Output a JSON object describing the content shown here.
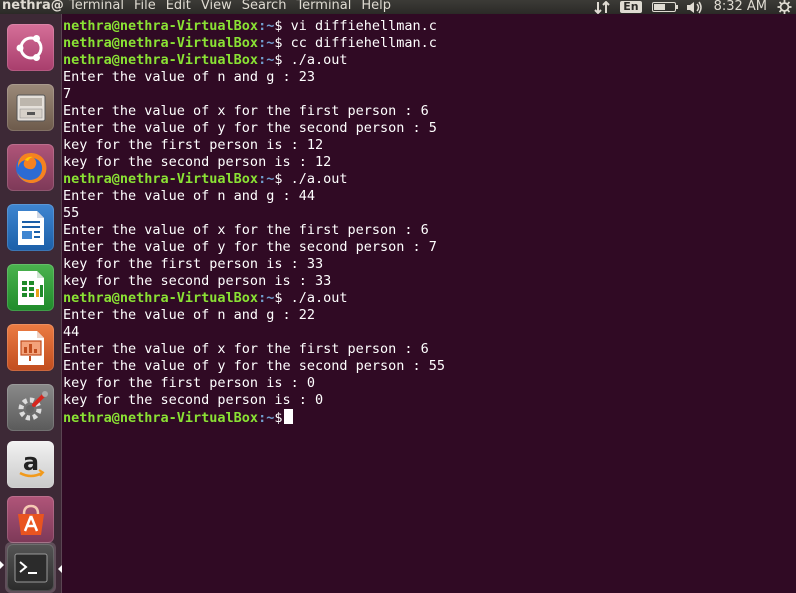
{
  "top_panel": {
    "app_title": "nethra@",
    "menu": [
      "Terminal",
      "File",
      "Edit",
      "View",
      "Search",
      "Terminal",
      "Help"
    ],
    "keyboard_layout": "En",
    "clock": "8:32 AM",
    "battery_level": 0.55,
    "icons": [
      "network-updown-icon",
      "keyboard-icon",
      "battery-icon",
      "volume-icon",
      "gear-icon"
    ]
  },
  "launcher": {
    "items": [
      {
        "name": "ubuntu-dash",
        "icon": "ubuntu-logo-icon",
        "color": "#c45a87"
      },
      {
        "name": "files",
        "icon": "file-cabinet-icon",
        "color": "#8a7462"
      },
      {
        "name": "firefox",
        "icon": "firefox-icon",
        "color": "#e66000"
      },
      {
        "name": "libreoffice-writer",
        "icon": "writer-doc-icon",
        "color": "#1b5fa8"
      },
      {
        "name": "libreoffice-calc",
        "icon": "calc-sheet-icon",
        "color": "#1f8b2a"
      },
      {
        "name": "libreoffice-impress",
        "icon": "impress-slide-icon",
        "color": "#d0592b"
      },
      {
        "name": "system-settings",
        "icon": "settings-wrench-icon",
        "color": "#777777"
      },
      {
        "name": "amazon",
        "icon": "amazon-icon",
        "color": "#dddddd"
      },
      {
        "name": "software-center",
        "icon": "software-bag-icon",
        "color": "#e95420"
      },
      {
        "name": "terminal",
        "icon": "terminal-prompt-icon",
        "color": "#333333"
      }
    ]
  },
  "terminal": {
    "prompt_user": "nethra@nethra-VirtualBox",
    "prompt_path": ":~",
    "prompt_symbol": "$",
    "lines": [
      {
        "type": "prompt",
        "cmd": " vi diffiehellman.c"
      },
      {
        "type": "prompt",
        "cmd": " cc diffiehellman.c"
      },
      {
        "type": "prompt",
        "cmd": " ./a.out"
      },
      {
        "type": "out",
        "text": "Enter the value of n and g : 23"
      },
      {
        "type": "out",
        "text": "7"
      },
      {
        "type": "out",
        "text": "Enter the value of x for the first person : 6"
      },
      {
        "type": "out",
        "text": "Enter the value of y for the second person : 5"
      },
      {
        "type": "out",
        "text": "key for the first person is : 12"
      },
      {
        "type": "out",
        "text": "key for the second person is : 12"
      },
      {
        "type": "prompt",
        "cmd": " ./a.out"
      },
      {
        "type": "out",
        "text": "Enter the value of n and g : 44"
      },
      {
        "type": "out",
        "text": "55"
      },
      {
        "type": "out",
        "text": "Enter the value of x for the first person : 6"
      },
      {
        "type": "out",
        "text": "Enter the value of y for the second person : 7"
      },
      {
        "type": "out",
        "text": "key for the first person is : 33"
      },
      {
        "type": "out",
        "text": "key for the second person is : 33"
      },
      {
        "type": "prompt",
        "cmd": " ./a.out"
      },
      {
        "type": "out",
        "text": "Enter the value of n and g : 22"
      },
      {
        "type": "out",
        "text": "44"
      },
      {
        "type": "out",
        "text": "Enter the value of x for the first person : 6"
      },
      {
        "type": "out",
        "text": "Enter the value of y for the second person : 55"
      },
      {
        "type": "out",
        "text": "key for the first person is : 0"
      },
      {
        "type": "out",
        "text": "key for the second person is : 0"
      },
      {
        "type": "prompt",
        "cmd": "",
        "cursor": true
      }
    ]
  }
}
